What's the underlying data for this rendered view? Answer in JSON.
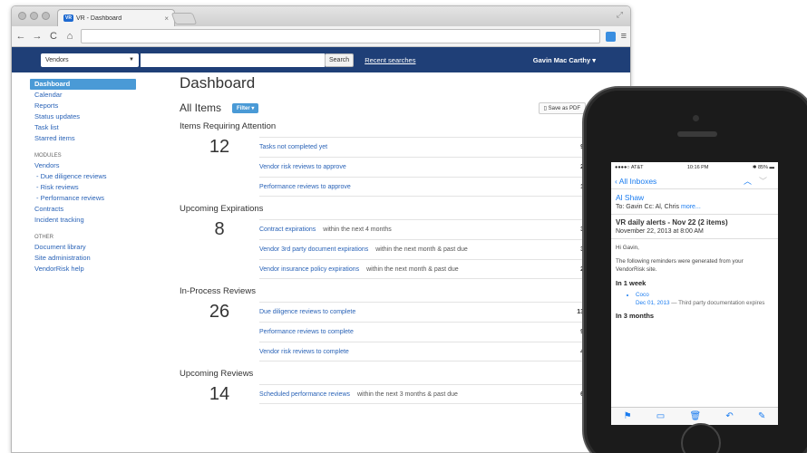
{
  "browser": {
    "tab_title": "VR - Dashboard",
    "tab_favicon": "VR",
    "tab_close": "×",
    "nav_back": "←",
    "nav_forward": "→",
    "nav_reload": "C",
    "nav_home": "⌂",
    "menu_icon": "≡"
  },
  "header": {
    "scope_select": "Vendors",
    "search_button": "Search",
    "recent_searches": "Recent searches",
    "user_menu": "Gavin Mac Carthy"
  },
  "sidebar": {
    "items": [
      {
        "label": "Dashboard",
        "active": true
      },
      {
        "label": "Calendar"
      },
      {
        "label": "Reports"
      },
      {
        "label": "Status updates"
      },
      {
        "label": "Task list"
      },
      {
        "label": "Starred items"
      }
    ],
    "modules_heading": "MODULES",
    "modules": [
      {
        "label": "Vendors"
      },
      {
        "label": "- Due diligence reviews",
        "sub": true
      },
      {
        "label": "- Risk reviews",
        "sub": true
      },
      {
        "label": "- Performance reviews",
        "sub": true
      },
      {
        "label": "Contracts"
      },
      {
        "label": "Incident tracking"
      }
    ],
    "other_heading": "OTHER",
    "other": [
      {
        "label": "Document library"
      },
      {
        "label": "Site administration"
      },
      {
        "label": "VendorRisk help"
      }
    ]
  },
  "main": {
    "title": "Dashboard",
    "all_items": "All Items",
    "filter_button": "Filter ▾",
    "save_pdf": "Save as PDF",
    "groups": [
      {
        "title": "Items Requiring Attention",
        "count": "12",
        "rows": [
          {
            "link": "Tasks not completed yet",
            "note": "",
            "count": "9"
          },
          {
            "link": "Vendor risk reviews to approve",
            "note": "",
            "count": "2"
          },
          {
            "link": "Performance reviews to approve",
            "note": "",
            "count": "1"
          }
        ]
      },
      {
        "title": "Upcoming Expirations",
        "count": "8",
        "rows": [
          {
            "link": "Contract expirations",
            "note": "within the next 4 months",
            "count": "3"
          },
          {
            "link": "Vendor 3rd party document expirations",
            "note": "within the next month & past due",
            "count": "3"
          },
          {
            "link": "Vendor insurance policy expirations",
            "note": "within the next month & past due",
            "count": "2"
          }
        ]
      },
      {
        "title": "In-Process Reviews",
        "count": "26",
        "rows": [
          {
            "link": "Due diligence reviews to complete",
            "note": "",
            "count": "13"
          },
          {
            "link": "Performance reviews to complete",
            "note": "",
            "count": "9"
          },
          {
            "link": "Vendor risk reviews to complete",
            "note": "",
            "count": "4"
          }
        ]
      },
      {
        "title": "Upcoming Reviews",
        "count": "14",
        "rows": [
          {
            "link": "Scheduled performance reviews",
            "note": "within the next 3 months & past due",
            "count": "6"
          }
        ]
      }
    ]
  },
  "phone": {
    "carrier": "●●●●○ AT&T",
    "time": "10:16 PM",
    "battery": "85%",
    "back_label": "‹ All Inboxes",
    "sender": "Al Shaw",
    "to_line": "To: Gavin  Cc: Al, Chris",
    "more": "more...",
    "subject": "VR daily alerts - Nov 22 (2 items)",
    "date": "November 22, 2013 at 8:00 AM",
    "greeting": "Hi Gavin,",
    "intro": "The following reminders were generated from your VendorRisk site.",
    "section1": "In 1 week",
    "item_link": "Coco",
    "item_date": "Dec 01, 2013",
    "item_desc": " — Third party documentation expires",
    "section2": "In 3 months"
  },
  "colors": {
    "header_bg": "#1f3f77",
    "accent": "#4a9ad6",
    "link": "#2a63b7",
    "ios_blue": "#1a7cf0"
  }
}
